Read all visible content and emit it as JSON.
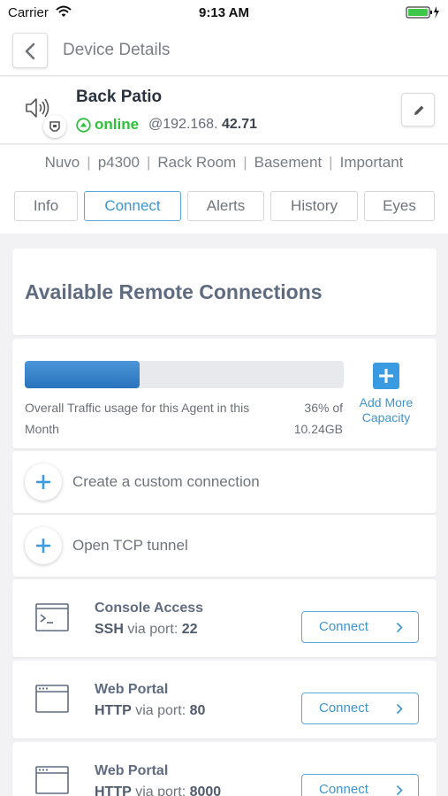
{
  "status_bar": {
    "carrier": "Carrier",
    "time": "9:13 AM"
  },
  "nav": {
    "title": "Device Details",
    "back_icon": "chevron-left-icon"
  },
  "device": {
    "name": "Back Patio",
    "status": "online",
    "ip_prefix": "@192.168.",
    "ip_suffix": "42.71",
    "status_color": "#2fbf3a",
    "icons": [
      "speaker-icon",
      "plug-icon",
      "status-up-icon",
      "pencil-icon"
    ]
  },
  "tags": [
    "Nuvo",
    "p4300",
    "Rack Room",
    "Basement",
    "Important"
  ],
  "tabs": [
    {
      "label": "Info",
      "active": false
    },
    {
      "label": "Connect",
      "active": true
    },
    {
      "label": "Alerts",
      "active": false
    },
    {
      "label": "History",
      "active": false
    },
    {
      "label": "Eyes",
      "active": false
    }
  ],
  "section_title": "Available Remote Connections",
  "usage": {
    "label": "Overall Traffic usage for this Agent in this Month",
    "percent_text": "36% of",
    "capacity_text": "10.24GB",
    "fill_fraction": 0.36,
    "add_capacity_line1": "Add More",
    "add_capacity_line2": "Capacity"
  },
  "actions": [
    {
      "label": "Create a custom connection"
    },
    {
      "label": "Open TCP tunnel"
    }
  ],
  "connections": [
    {
      "name": "Console Access",
      "protocol": "SSH",
      "via": "via port:",
      "port": "22",
      "button": "Connect",
      "icon": "terminal-icon"
    },
    {
      "name": "Web Portal",
      "protocol": "HTTP",
      "via": "via port:",
      "port": "80",
      "button": "Connect",
      "icon": "browser-window-icon"
    },
    {
      "name": "Web Portal",
      "protocol": "HTTP",
      "via": "via port:",
      "port": "8000",
      "button": "Connect",
      "icon": "browser-window-icon"
    }
  ],
  "colors": {
    "accent": "#3e95cf",
    "online": "#2fbf3a",
    "background": "#f2f2f4"
  }
}
